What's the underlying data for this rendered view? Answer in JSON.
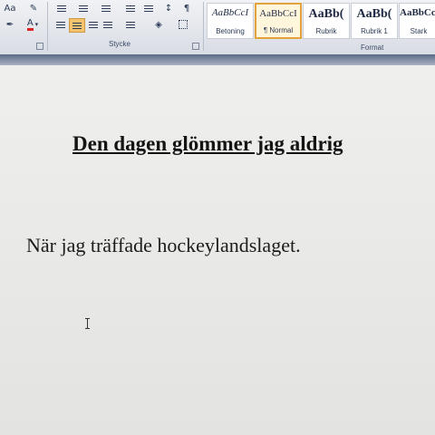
{
  "ribbon": {
    "font_group": {
      "font_size_icon": "Aa",
      "highlight_icon": "highlighter-icon",
      "font_color_icon": "A",
      "font_color_accent": "#d22"
    },
    "paragraph_group": {
      "label": "Stycke",
      "pilcrow": "¶"
    },
    "styles_group": {
      "label": "Format",
      "styles": [
        {
          "sample": "AaBbCcI",
          "name": "Betoning",
          "selected": false
        },
        {
          "sample": "AaBbCcI",
          "name": "¶ Normal",
          "selected": true
        },
        {
          "sample": "AaBb(",
          "name": "Rubrik",
          "selected": false
        },
        {
          "sample": "AaBb(",
          "name": "Rubrik 1",
          "selected": false
        },
        {
          "sample": "AaBbCcI",
          "name": "Stark",
          "selected": false
        }
      ]
    },
    "selected_tool_color": "#f6c26e"
  },
  "document": {
    "title": "Den dagen glömmer jag aldrig",
    "paragraph": "När jag träffade hockeylandslaget."
  }
}
